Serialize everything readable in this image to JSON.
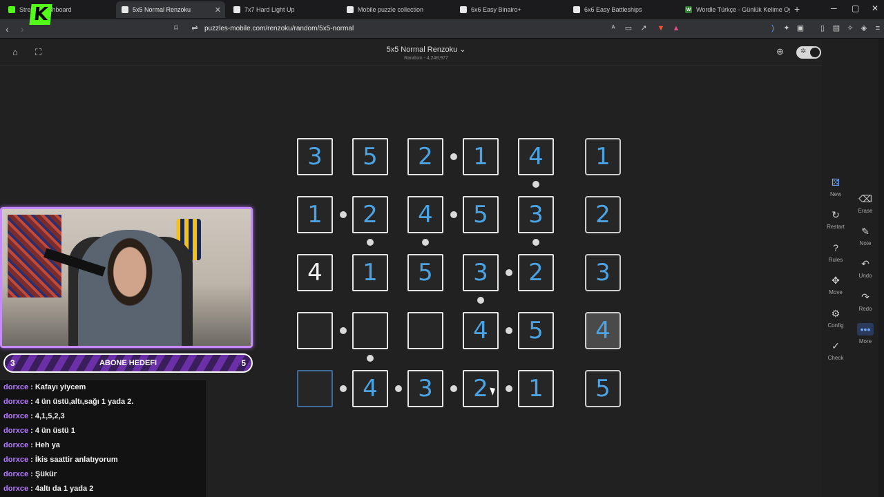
{
  "browser": {
    "tabs": [
      {
        "label": "Stream Dashboard",
        "favicon": "K"
      },
      {
        "label": "5x5 Normal Renzoku",
        "favicon": "r",
        "active": true
      },
      {
        "label": "7x7 Hard Light Up",
        "favicon": "r"
      },
      {
        "label": "Mobile puzzle collection",
        "favicon": "r"
      },
      {
        "label": "6x6 Easy Binairo+",
        "favicon": "r"
      },
      {
        "label": "6x6 Easy Battleships",
        "favicon": "r"
      },
      {
        "label": "Wordle Türkçe - Günlük Kelime Oyu",
        "favicon": "W"
      }
    ],
    "url": "puzzles-mobile.com/renzoku/random/5x5-normal"
  },
  "header": {
    "title": "5x5 Normal Renzoku",
    "subtitle": "Random - 4,248,977"
  },
  "grid": {
    "rows": [
      [
        {
          "v": "3",
          "given": false
        },
        {
          "v": "5",
          "given": false
        },
        {
          "v": "2",
          "given": false
        },
        {
          "v": "1",
          "given": false
        },
        {
          "v": "4",
          "given": false
        }
      ],
      [
        {
          "v": "1",
          "given": false
        },
        {
          "v": "2",
          "given": false
        },
        {
          "v": "4",
          "given": false
        },
        {
          "v": "5",
          "given": false
        },
        {
          "v": "3",
          "given": false
        }
      ],
      [
        {
          "v": "4",
          "given": true
        },
        {
          "v": "1",
          "given": false
        },
        {
          "v": "5",
          "given": false
        },
        {
          "v": "3",
          "given": false
        },
        {
          "v": "2",
          "given": false
        }
      ],
      [
        {
          "v": "",
          "given": false
        },
        {
          "v": "",
          "given": false
        },
        {
          "v": "",
          "given": false
        },
        {
          "v": "4",
          "given": false
        },
        {
          "v": "5",
          "given": false
        }
      ],
      [
        {
          "v": "",
          "given": false,
          "selected": true
        },
        {
          "v": "4",
          "given": false
        },
        {
          "v": "3",
          "given": false
        },
        {
          "v": "2",
          "given": false
        },
        {
          "v": "1",
          "given": false
        }
      ]
    ],
    "side_column": [
      "1",
      "2",
      "3",
      "4",
      "5"
    ],
    "highlighted_side": "4"
  },
  "sidebar": {
    "items": [
      {
        "label": "New",
        "icon": "dice-icon"
      },
      {
        "label": "Erase",
        "icon": "eraser-icon"
      },
      {
        "label": "Restart",
        "icon": "restart-icon"
      },
      {
        "label": "Note",
        "icon": "note-icon"
      },
      {
        "label": "Rules",
        "icon": "help-icon"
      },
      {
        "label": "Undo",
        "icon": "undo-icon"
      },
      {
        "label": "Move",
        "icon": "move-icon"
      },
      {
        "label": "Redo",
        "icon": "redo-icon"
      },
      {
        "label": "Config",
        "icon": "gear-icon"
      },
      {
        "label": "More",
        "icon": "more-icon"
      },
      {
        "label": "Check",
        "icon": "check-icon"
      }
    ]
  },
  "goal": {
    "left": "3",
    "title": "ABONE HEDEFI",
    "right": "5"
  },
  "chat": [
    {
      "user": "dorxce",
      "text": " : Kafayı yiycem"
    },
    {
      "user": "dorxce",
      "text": " : 4 ün üstü,altı,sağı 1 yada 2."
    },
    {
      "user": "dorxce",
      "text": " : 4,1,5,2,3"
    },
    {
      "user": "dorxce",
      "text": " : 4 ün üstü 1"
    },
    {
      "user": "dorxce",
      "text": " : Heh ya"
    },
    {
      "user": "dorxce",
      "text": " : İkis saattir anlatıyorum"
    },
    {
      "user": "dorxce",
      "text": " : Şükür"
    },
    {
      "user": "dorxce",
      "text": " : 4altı da 1 yada 2"
    }
  ]
}
